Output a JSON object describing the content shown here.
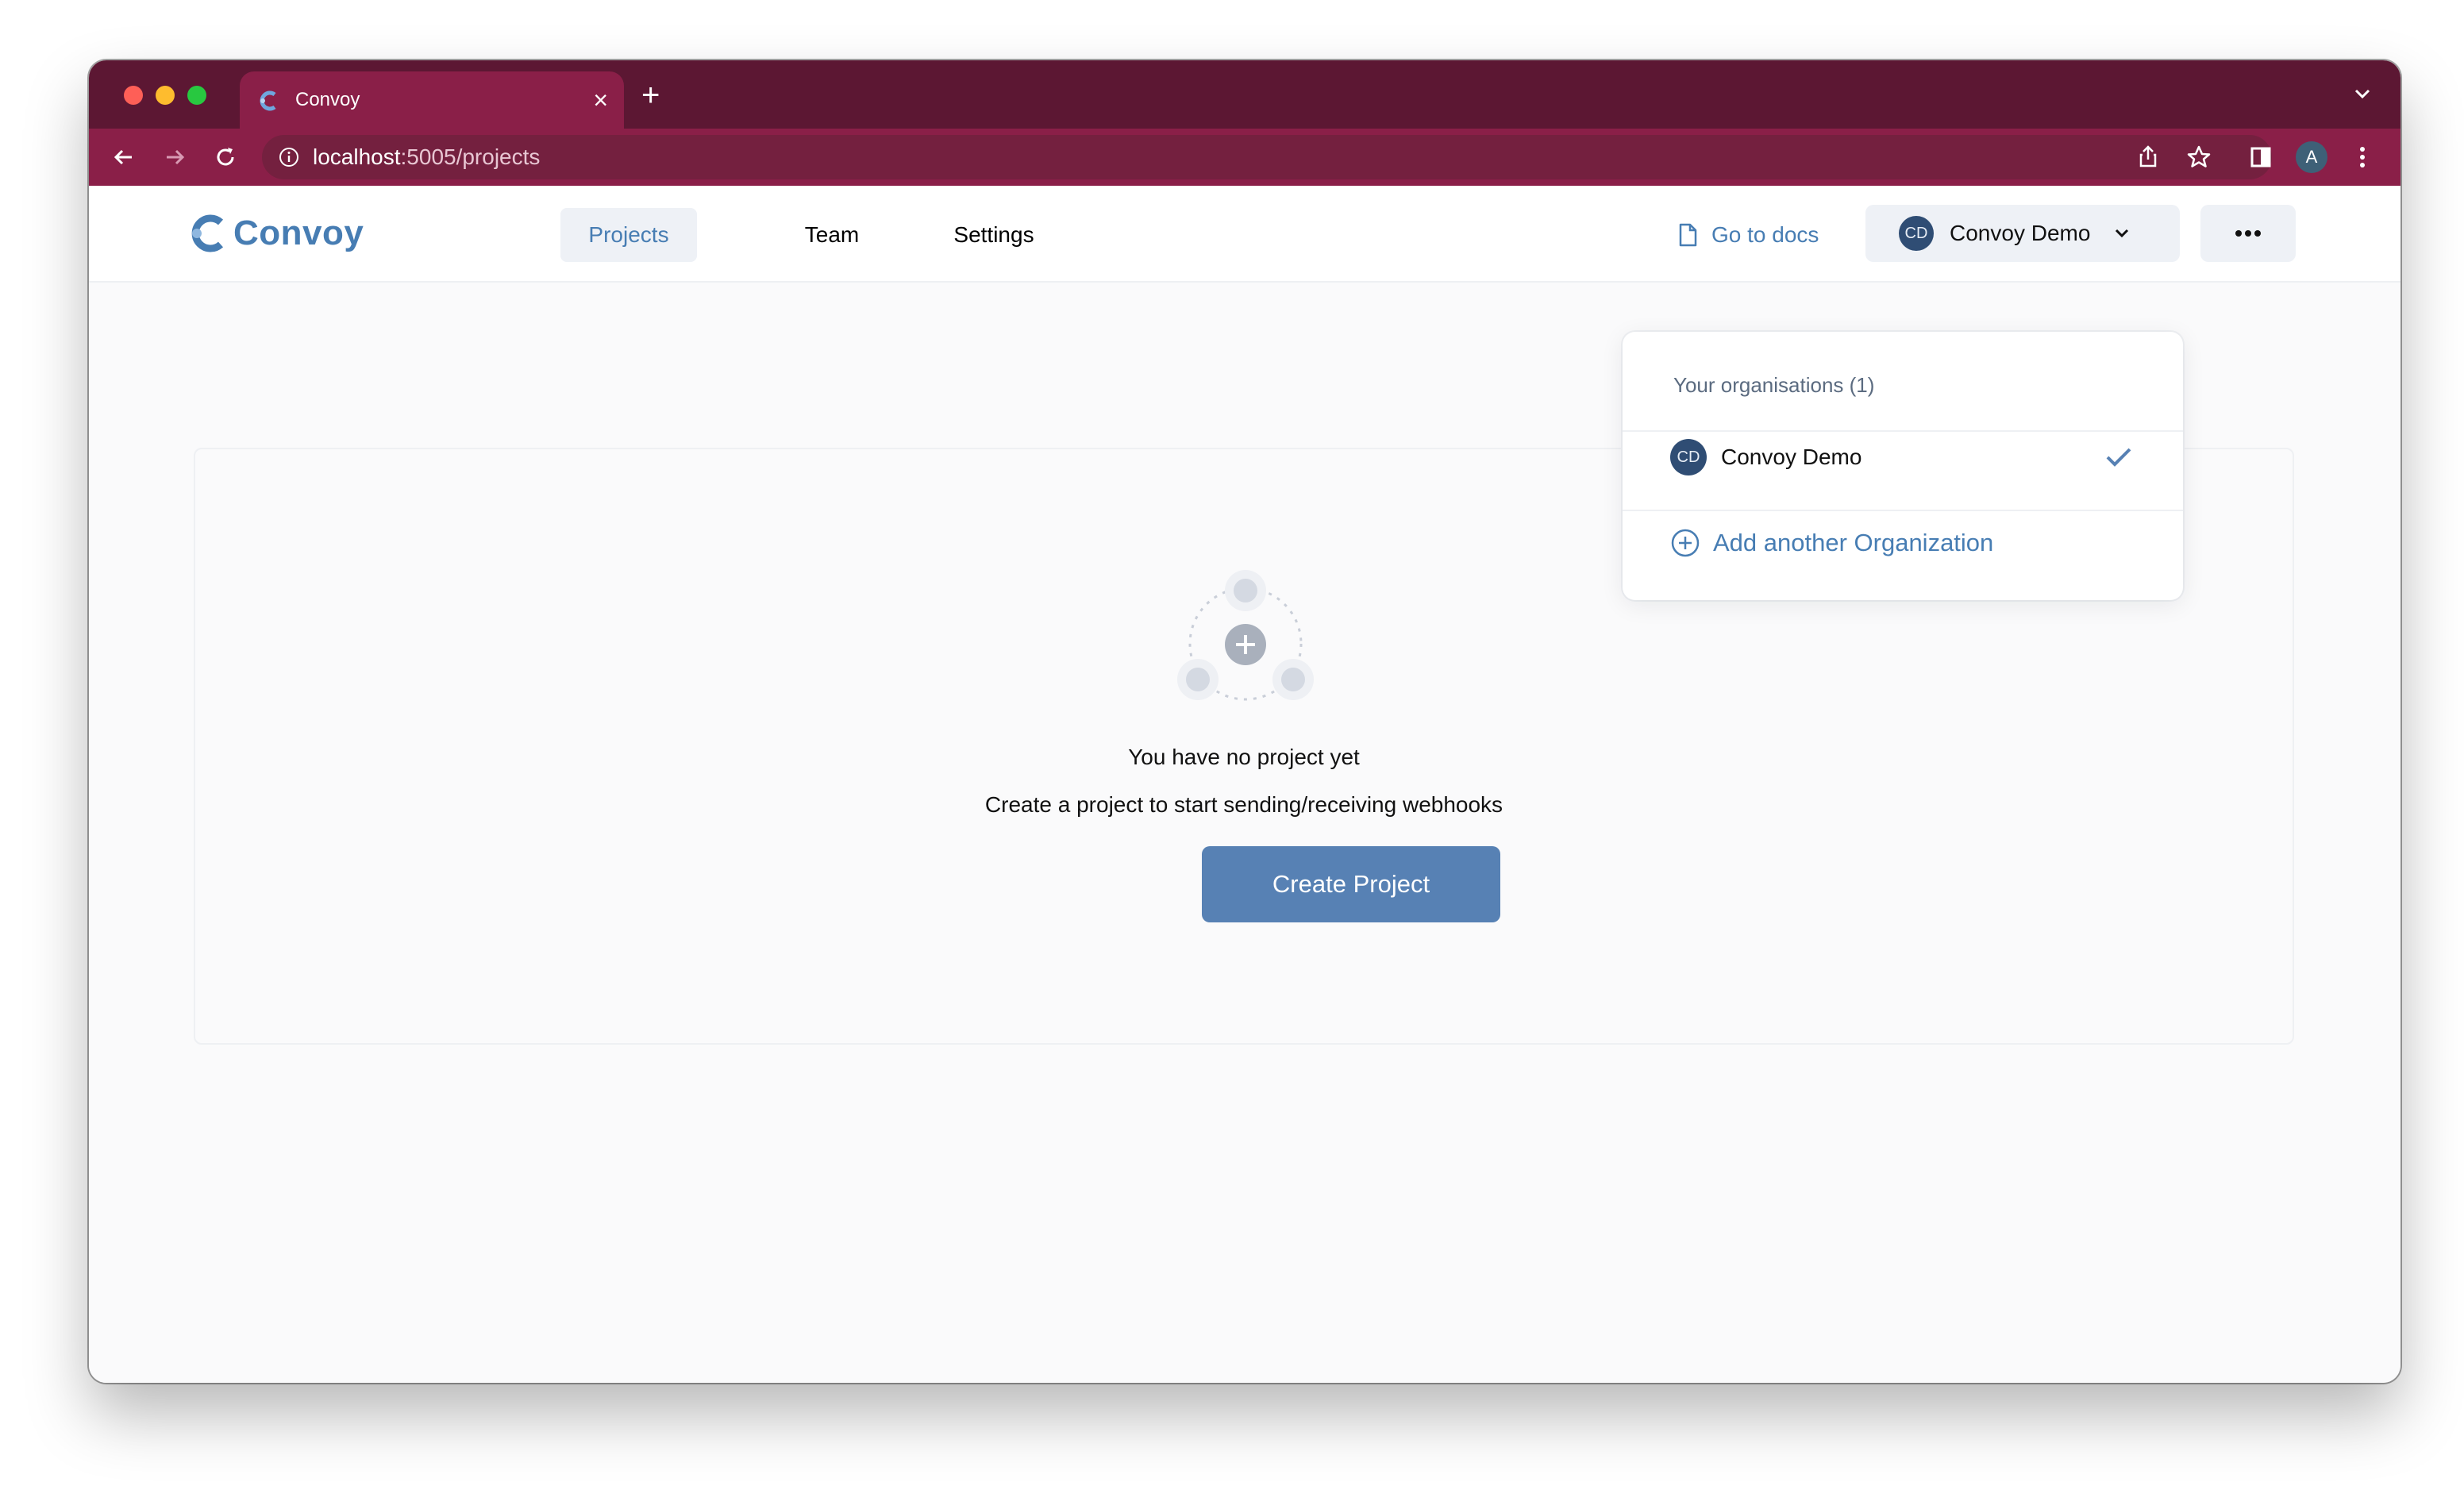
{
  "browser": {
    "tab_title": "Convoy",
    "url_host": "localhost",
    "url_path": ":5005/projects",
    "profile_initial": "A"
  },
  "header": {
    "logo_text": "Convoy",
    "nav": {
      "projects": "Projects",
      "team": "Team",
      "settings": "Settings"
    },
    "docs_label": "Go to docs",
    "org_initials": "CD",
    "org_name": "Convoy Demo"
  },
  "dropdown": {
    "heading": "Your organisations (1)",
    "org_initials": "CD",
    "org_name": "Convoy Demo",
    "add_label": "Add another Organization"
  },
  "empty_state": {
    "title": "You have no project yet",
    "subtitle": "Create a project to start sending/receiving webhooks",
    "button": "Create Project"
  },
  "colors": {
    "accent": "#477db3",
    "button": "#5781b4",
    "tab_bar": "#5c1733",
    "toolbar": "#8a1f48"
  }
}
